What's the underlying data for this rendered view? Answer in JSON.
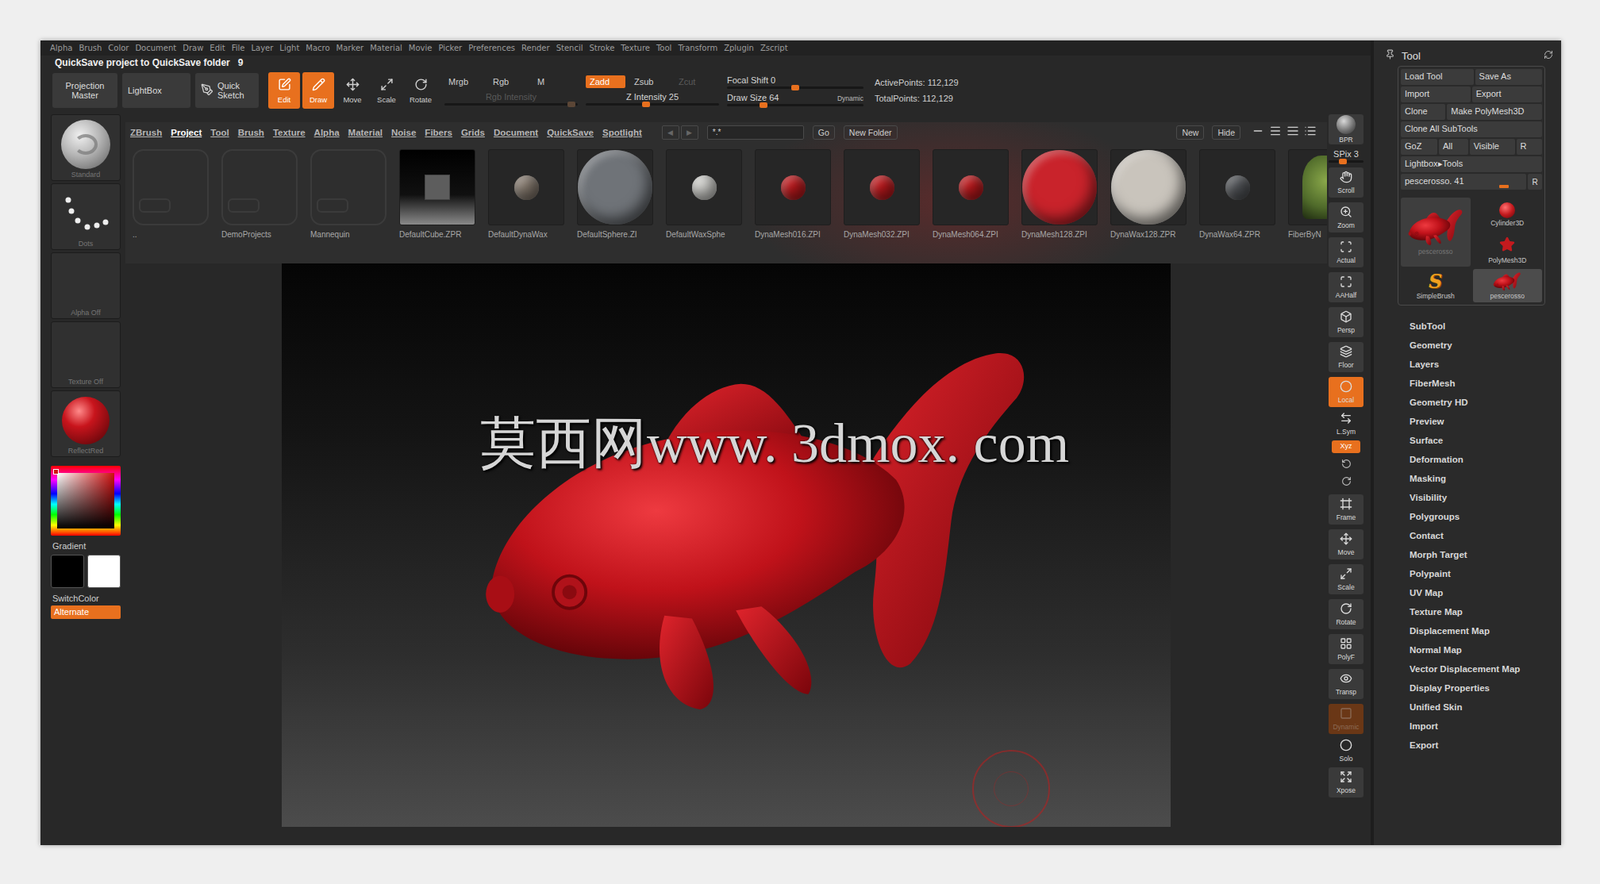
{
  "menu_bar": [
    "Alpha",
    "Brush",
    "Color",
    "Document",
    "Draw",
    "Edit",
    "File",
    "Layer",
    "Light",
    "Macro",
    "Marker",
    "Material",
    "Movie",
    "Picker",
    "Preferences",
    "Render",
    "Stencil",
    "Stroke",
    "Texture",
    "Tool",
    "Transform",
    "Zplugin",
    "Zscript"
  ],
  "status": {
    "message": "QuickSave project to QuickSave folder",
    "count": "9"
  },
  "top_shelf": {
    "buttons": [
      {
        "label": "Projection Master",
        "kind": "menu"
      },
      {
        "label": "LightBox",
        "kind": "plain"
      },
      {
        "label": "Quick Sketch",
        "kind": "sketch"
      }
    ],
    "tools": [
      {
        "label": "Edit",
        "selected": true
      },
      {
        "label": "Draw",
        "selected": true
      },
      {
        "label": "Move",
        "selected": false
      },
      {
        "label": "Scale",
        "selected": false
      },
      {
        "label": "Rotate",
        "selected": false
      }
    ],
    "mode_groups": [
      {
        "modes": [
          {
            "label": "Mrgb",
            "selected": false,
            "disabled": false
          },
          {
            "label": "Rgb",
            "selected": false,
            "disabled": false
          },
          {
            "label": "M",
            "selected": false,
            "disabled": false
          }
        ],
        "slider": {
          "label": "Rgb Intensity",
          "level": 0.95,
          "disabled": true
        }
      },
      {
        "modes": [
          {
            "label": "Zadd",
            "selected": true,
            "disabled": false
          },
          {
            "label": "Zsub",
            "selected": false,
            "disabled": false
          },
          {
            "label": "Zcut",
            "selected": false,
            "disabled": true
          }
        ],
        "slider": {
          "label": "Z Intensity 25",
          "level": 0.45,
          "disabled": false
        }
      }
    ],
    "sliders": [
      {
        "label": "Focal Shift 0",
        "level": 0.5
      },
      {
        "label": "Draw Size 64",
        "level": 0.27
      }
    ],
    "dynamic": "Dynamic",
    "stats": [
      "ActivePoints: 112,129",
      "TotalPoints: 112,129"
    ]
  },
  "left_shelf": {
    "tiles": [
      {
        "label": "Standard",
        "kind": "brush"
      },
      {
        "label": "Dots",
        "kind": "stroke"
      },
      {
        "label": "Alpha Off",
        "kind": "empty"
      },
      {
        "label": "Texture Off",
        "kind": "empty"
      },
      {
        "label": "ReflectRed",
        "kind": "material"
      }
    ],
    "color_label": "Gradient",
    "swatches": [
      {
        "color": "#000000"
      },
      {
        "color": "#ffffff"
      }
    ],
    "switch": "SwitchColor",
    "alternate": {
      "label": "Alternate",
      "selected": true
    }
  },
  "lightbox": {
    "tabs": [
      {
        "label": "ZBrush",
        "selected": false
      },
      {
        "label": "Project",
        "selected": true
      },
      {
        "label": "Tool",
        "selected": false
      },
      {
        "label": "Brush",
        "selected": false
      },
      {
        "label": "Texture",
        "selected": false
      },
      {
        "label": "Alpha",
        "selected": false
      },
      {
        "label": "Material",
        "selected": false
      },
      {
        "label": "Noise",
        "selected": false
      },
      {
        "label": "Fibers",
        "selected": false
      },
      {
        "label": "Grids",
        "selected": false
      },
      {
        "label": "Document",
        "selected": false
      },
      {
        "label": "QuickSave",
        "selected": false
      },
      {
        "label": "Spotlight",
        "selected": false
      }
    ],
    "nav": [
      "◀",
      "▶"
    ],
    "search": "*.*",
    "go": "Go",
    "new_folder": "New Folder",
    "actions": [
      "New",
      "Hide"
    ],
    "items": [
      {
        "label": "..",
        "kind": "folder"
      },
      {
        "label": "DemoProjects",
        "kind": "folder"
      },
      {
        "label": "Mannequin",
        "kind": "folder"
      },
      {
        "label": "DefaultCube.ZPR",
        "kind": "cube"
      },
      {
        "label": "DefaultDynaWax",
        "kind": "ball",
        "color": "#8a7e72"
      },
      {
        "label": "DefaultSphere.ZI",
        "kind": "bigball",
        "color": "#6f7378"
      },
      {
        "label": "DefaultWaxSphe",
        "kind": "ball",
        "color": "#d8d8d4"
      },
      {
        "label": "DynaMesh016.ZPI",
        "kind": "ball",
        "color": "#c41a1e"
      },
      {
        "label": "DynaMesh032.ZPI",
        "kind": "ball",
        "color": "#c41a1e"
      },
      {
        "label": "DynaMesh064.ZPI",
        "kind": "ball",
        "color": "#c41a1e"
      },
      {
        "label": "DynaMesh128.ZPI",
        "kind": "bigball",
        "color": "#c9232b"
      },
      {
        "label": "DynaWax128.ZPR",
        "kind": "bigball",
        "color": "#c9c4bc"
      },
      {
        "label": "DynaWax64.ZPR",
        "kind": "ball",
        "color": "#55585c"
      },
      {
        "label": "FiberByN",
        "kind": "plant",
        "color": "#4f6a2a"
      }
    ]
  },
  "canvas": {
    "watermark": "莫西网www. 3dmox. com"
  },
  "right_shelf": [
    {
      "kind": "button",
      "label": "BPR",
      "selected": false,
      "disabled": false
    },
    {
      "kind": "slider",
      "label": "SPix 3",
      "level": 0.4,
      "selected": false,
      "disabled": false
    },
    {
      "kind": "button",
      "label": "Scroll",
      "selected": false,
      "disabled": false
    },
    {
      "kind": "button",
      "label": "Zoom",
      "selected": false,
      "disabled": false
    },
    {
      "kind": "button",
      "label": "Actual",
      "selected": false,
      "disabled": false
    },
    {
      "kind": "button",
      "label": "AAHalf",
      "selected": false,
      "disabled": false
    },
    {
      "kind": "button",
      "label": "Persp",
      "selected": false,
      "disabled": false
    },
    {
      "kind": "button",
      "label": "Floor",
      "selected": false,
      "disabled": false
    },
    {
      "kind": "button",
      "label": "Local",
      "selected": true,
      "disabled": false
    },
    {
      "kind": "plain",
      "label": "L.Sym",
      "selected": false,
      "disabled": false
    },
    {
      "kind": "pill",
      "label": "Xyz",
      "selected": true,
      "disabled": false
    },
    {
      "kind": "pair",
      "selected": false,
      "disabled": false
    },
    {
      "kind": "button",
      "label": "Frame",
      "selected": false,
      "disabled": false
    },
    {
      "kind": "button",
      "label": "Move",
      "selected": false,
      "disabled": false
    },
    {
      "kind": "button",
      "label": "Scale",
      "selected": false,
      "disabled": false
    },
    {
      "kind": "button",
      "label": "Rotate",
      "selected": false,
      "disabled": false
    },
    {
      "kind": "button",
      "label": "PolyF",
      "selected": false,
      "disabled": false
    },
    {
      "kind": "button",
      "label": "Transp",
      "selected": false,
      "disabled": false
    },
    {
      "kind": "button",
      "label": "Dynamic",
      "selected": true,
      "disabled": true
    },
    {
      "kind": "plain",
      "label": "Solo",
      "selected": false,
      "disabled": false
    },
    {
      "kind": "button",
      "label": "Xpose",
      "selected": false,
      "disabled": false
    }
  ],
  "tool_panel": {
    "title": "Tool",
    "rows": [
      [
        "Load Tool",
        "Save As"
      ],
      [
        "Import",
        "Export"
      ],
      [
        "Clone",
        "Make PolyMesh3D"
      ],
      [
        "Clone All SubTools"
      ],
      [
        "GoZ",
        "All",
        "Visible",
        "R"
      ],
      [
        "Lightbox▸Tools"
      ]
    ],
    "slider": {
      "label": "pescerosso. 41",
      "level": 0.82,
      "reset": "R"
    },
    "thumbs": [
      {
        "label": "pescerosso",
        "kind": "fish",
        "selected": true
      },
      {
        "label": "Cylinder3D",
        "kind": "ball",
        "selected": false
      },
      {
        "label": "PolyMesh3D",
        "kind": "star",
        "selected": false
      },
      {
        "label": "SimpleBrush",
        "kind": "glyph",
        "glyph": "S",
        "selected": false
      },
      {
        "label": "pescerosso",
        "kind": "fishsmall",
        "selected": false
      }
    ],
    "sections": [
      "SubTool",
      "Geometry",
      "Layers",
      "FiberMesh",
      "Geometry HD",
      "Preview",
      "Surface",
      "Deformation",
      "Masking",
      "Visibility",
      "Polygroups",
      "Contact",
      "Morph Target",
      "Polypaint",
      "UV Map",
      "Texture Map",
      "Displacement Map",
      "Normal Map",
      "Vector Displacement Map",
      "Display Properties",
      "Unified Skin",
      "Import",
      "Export"
    ]
  }
}
